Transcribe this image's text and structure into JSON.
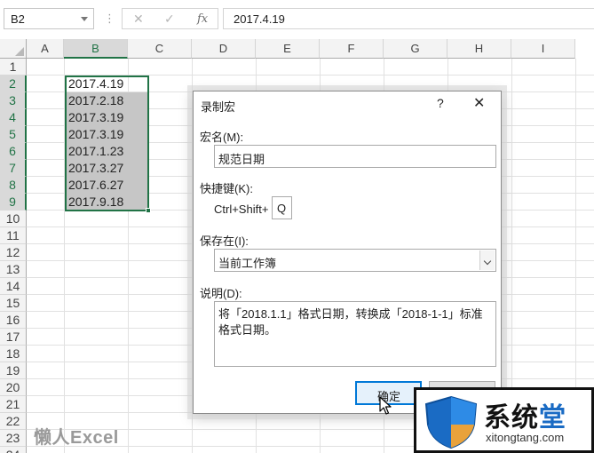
{
  "formula_bar": {
    "name_box": "B2",
    "cancel_icon": "✕",
    "enter_icon": "✓",
    "fx_label": "fx",
    "value": "2017.4.19"
  },
  "sheet": {
    "columns": [
      "A",
      "B",
      "C",
      "D",
      "E",
      "F",
      "G",
      "H",
      "I"
    ],
    "selected_column": "B",
    "rows": [
      "1",
      "2",
      "3",
      "4",
      "5",
      "6",
      "7",
      "8",
      "9",
      "10",
      "11",
      "12",
      "13",
      "14",
      "15",
      "16",
      "17",
      "18",
      "19",
      "20",
      "21",
      "22",
      "23",
      "24"
    ],
    "selected_rows": [
      "2",
      "3",
      "4",
      "5",
      "6",
      "7",
      "8",
      "9"
    ],
    "column_b_values": [
      "2017.4.19",
      "2017.2.18",
      "2017.3.19",
      "2017.3.19",
      "2017.1.23",
      "2017.3.27",
      "2017.6.27",
      "2017.9.18"
    ],
    "active_cell": "B2",
    "selection": "B2:B9"
  },
  "watermark": "懒人Excel",
  "dialog": {
    "title": "录制宏",
    "help": "?",
    "close": "✕",
    "macro_name_label": "宏名(M):",
    "macro_name_value": "规范日期",
    "shortcut_label": "快捷键(K):",
    "shortcut_prefix": "Ctrl+Shift+",
    "shortcut_key": "Q",
    "store_in_label": "保存在(I):",
    "store_in_value": "当前工作簿",
    "description_label": "说明(D):",
    "description_value": "将「2018.1.1」格式日期，转换成「2018-1-1」标准格式日期。",
    "ok_label": "确定"
  },
  "logo": {
    "brand_prefix": "系统",
    "brand_accent": "堂",
    "site": "xitongtang.com"
  },
  "colors": {
    "excel_green": "#217346",
    "selection_fill": "#c6c6c6",
    "ok_border": "#0078d7",
    "logo_blue": "#1a6bc4"
  }
}
